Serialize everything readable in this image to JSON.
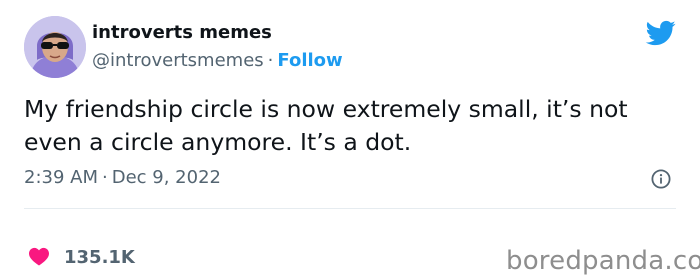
{
  "account": {
    "display_name": "introverts memes",
    "handle": "@introvertsmemes",
    "separator": "·",
    "follow_label": "Follow"
  },
  "tweet": {
    "text_line1": "My friendship circle is now extremely small, it’s not",
    "text_line2": "even a circle anymore. It’s a dot.",
    "time": "2:39 AM",
    "date": "Dec 9, 2022",
    "separator": "·",
    "likes": "135.1K"
  },
  "watermark": "boredpanda.com",
  "icons": {
    "brand": "twitter-bird-icon",
    "info": "info-icon",
    "like": "heart-icon"
  },
  "colors": {
    "accent": "#1d9bf0",
    "heart": "#f91880",
    "muted": "#536471",
    "avatar_bg": "#c9c4ec"
  }
}
